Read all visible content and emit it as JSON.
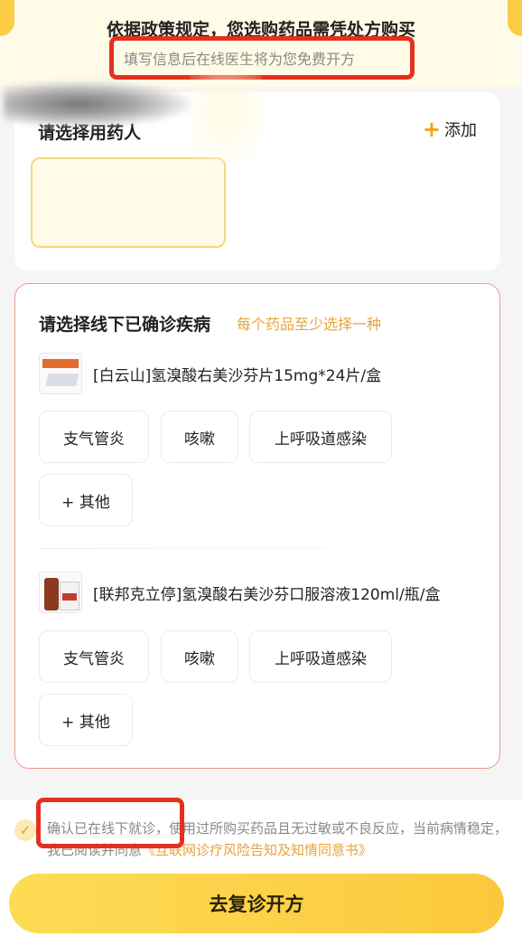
{
  "notice": {
    "title": "依据政策规定，您选购药品需凭处方购买",
    "subtitle": "填写信息后在线医生将为您免费开方"
  },
  "patient": {
    "title": "请选择用药人",
    "add_label": "添加"
  },
  "disease": {
    "title": "请选择线下已确诊疾病",
    "hint": "每个药品至少选择一种",
    "drugs": [
      {
        "name": "[白云山]氢溴酸右美沙芬片15mg*24片/盒",
        "tags": [
          "支气管炎",
          "咳嗽",
          "上呼吸道感染",
          "+ 其他"
        ]
      },
      {
        "name": "[联邦克立停]氢溴酸右美沙芬口服溶液120ml/瓶/盒",
        "tags": [
          "支气管炎",
          "咳嗽",
          "上呼吸道感染",
          "+ 其他"
        ]
      }
    ]
  },
  "consent": {
    "text": "确认已在线下就诊，使用过所购买药品且无过敏或不良反应，当前病情稳定，我已阅读并同意",
    "link": "《互联网诊疗风险告知及知情同意书》",
    "checked": true
  },
  "cta": {
    "label": "去复诊开方"
  },
  "colors": {
    "accent": "#fbcd45",
    "highlight_box": "#e5301f",
    "hint_text": "#e8a23b"
  }
}
